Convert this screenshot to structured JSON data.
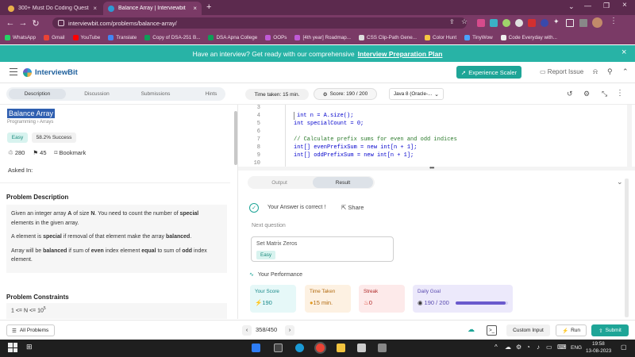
{
  "browser": {
    "tabs": [
      {
        "title": "300+ Must Do Coding Question..."
      },
      {
        "title": "Balance Array | Interviewbit"
      }
    ],
    "url": "interviewbit.com/problems/balance-array/",
    "bookmarks": [
      "WhatsApp",
      "Gmail",
      "YouTube",
      "Translate",
      "Copy of DSA-251 B...",
      "DSA Apna College",
      "OOPs",
      "[4th year] Roadmap...",
      "CSS Clip-Path Gene...",
      "Color Hunt",
      "TinyWow",
      "Code Everyday with..."
    ]
  },
  "banner": {
    "text": "Have an interview? Get ready with our comprehensive",
    "link": "Interview Preparation Plan",
    "close": "×"
  },
  "header": {
    "logo": "InterviewBit",
    "cta": "Experience Scaler",
    "report": "Report Issue"
  },
  "toolbar": {
    "tabs": [
      "Description",
      "Discussion",
      "Submissions",
      "Hints"
    ],
    "time": "Time taken: 15 min.",
    "score": "Score: 190 / 200",
    "language": "Java 8 (Oracle-..."
  },
  "problem": {
    "title": "Balance Array",
    "breadcrumb": "Programming › Arrays",
    "difficulty": "Easy",
    "success": "58.2% Success",
    "likes": "280",
    "dislikes": "45",
    "bookmark": "Bookmark",
    "asked_in": "Asked In:",
    "desc_heading": "Problem Description",
    "desc_p1_a": "Given an integer array ",
    "desc_p1_b": "A",
    "desc_p1_c": " of size ",
    "desc_p1_d": "N",
    "desc_p1_e": ". You need to count the number of ",
    "desc_p1_f": "special",
    "desc_p1_g": "elements in the given array.",
    "desc_p2_a": "A element is ",
    "desc_p2_b": "special",
    "desc_p2_c": " if removal of that element make the array ",
    "desc_p2_d": "balanced",
    "desc_p2_e": ".",
    "desc_p3_a": "Array will be ",
    "desc_p3_b": "balanced",
    "desc_p3_c": " if sum of ",
    "desc_p3_d": "even",
    "desc_p3_e": " index element ",
    "desc_p3_f": "equal",
    "desc_p3_g": " to sum of ",
    "desc_p3_h": "odd",
    "desc_p3_i": " index",
    "desc_p3_j": "element.",
    "constraints_heading": "Problem Constraints",
    "constraint_1": "1 <= N <= 10",
    "constraint_1_exp": "5"
  },
  "editor": {
    "lines": [
      {
        "n": "3",
        "code": ""
      },
      {
        "n": "4",
        "code": "int n = A.size();"
      },
      {
        "n": "5",
        "code": "int specialCount = 0;"
      },
      {
        "n": "6",
        "code": ""
      },
      {
        "n": "7",
        "code": "// Calculate prefix sums for even and odd indices"
      },
      {
        "n": "8",
        "code": "int[] evenPrefixSum = new int[n + 1];"
      },
      {
        "n": "9",
        "code": "int[] oddPrefixSum = new int[n + 1];"
      },
      {
        "n": "10",
        "code": ""
      }
    ]
  },
  "result": {
    "tabs": [
      "Output",
      "Result"
    ],
    "correct": "Your Answer is correct !",
    "share": "Share",
    "next_label": "Next question",
    "next_title": "Set Matrix Zeros",
    "next_diff": "Easy",
    "perf_heading": "Your Performance",
    "stats": [
      {
        "label": "Your Score",
        "value": "190",
        "bg": "#e6f8f8",
        "fg": "#1a8a8a"
      },
      {
        "label": "Time Taken",
        "value": "15 min.",
        "bg": "#fdf1e2",
        "fg": "#b26b10"
      },
      {
        "label": "Streak",
        "value": "0",
        "bg": "#fdeaea",
        "fg": "#b02a2a"
      },
      {
        "label": "Daily Goal",
        "value": "190 / 200",
        "bg": "#ece9fb",
        "fg": "#5a4bb0"
      }
    ],
    "daily_goal_progress": 0.95
  },
  "bottom": {
    "all_problems": "All Problems",
    "pager": "358/450",
    "custom_input": "Custom Input",
    "run": "Run",
    "submit": "Submit"
  },
  "taskbar": {
    "lang": "ENG",
    "time": "19:58",
    "date": "13-08-2023"
  },
  "colors": {
    "teal": "#1ea597",
    "purple": "#7a3a66",
    "banner": "#28b3a6"
  }
}
